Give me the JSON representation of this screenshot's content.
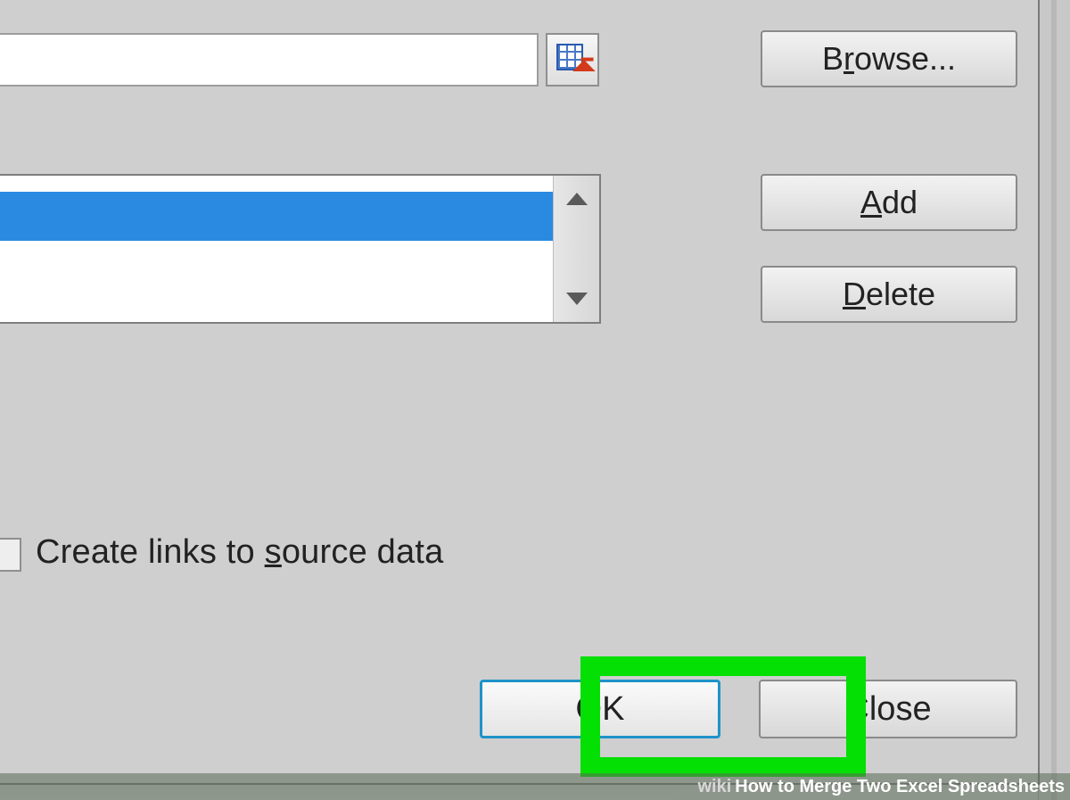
{
  "buttons": {
    "browse_pre": "B",
    "browse_ul": "r",
    "browse_post": "owse...",
    "add_pre": "",
    "add_ul": "A",
    "add_post": "dd",
    "delete_pre": "",
    "delete_ul": "D",
    "delete_post": "elete",
    "ok": "OK",
    "close": "Close"
  },
  "checkbox": {
    "pre": "Create links to ",
    "ul": "s",
    "post": "ource data"
  },
  "watermark": {
    "brand": "wiki",
    "title": "How to Merge Two Excel Spreadsheets"
  }
}
